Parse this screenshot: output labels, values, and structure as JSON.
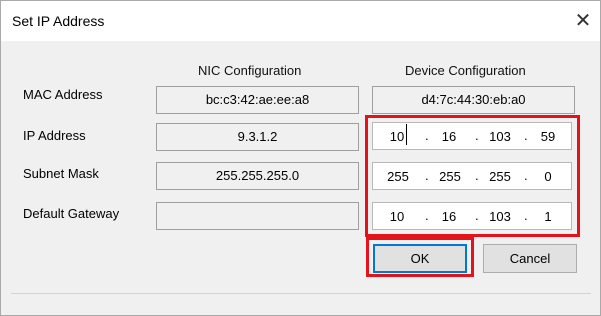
{
  "window": {
    "title": "Set IP Address",
    "close_glyph": "✕"
  },
  "columns": {
    "nic": "NIC Configuration",
    "device": "Device Configuration"
  },
  "rows": {
    "mac": {
      "label": "MAC Address",
      "nic": "bc:c3:42:ae:ee:a8",
      "device": "d4:7c:44:30:eb:a0"
    },
    "ip": {
      "label": "IP Address",
      "nic": "9.3.1.2",
      "device": [
        "10",
        "16",
        "103",
        "59"
      ]
    },
    "subnet": {
      "label": "Subnet Mask",
      "nic": "255.255.255.0",
      "device": [
        "255",
        "255",
        "255",
        "0"
      ]
    },
    "gateway": {
      "label": "Default Gateway",
      "nic": "",
      "device": [
        "10",
        "16",
        "103",
        "1"
      ]
    }
  },
  "buttons": {
    "ok": "OK",
    "cancel": "Cancel"
  },
  "colors": {
    "highlight": "#e3131b",
    "default_button_border": "#0078d7"
  },
  "icons": {
    "close": "close-icon"
  }
}
